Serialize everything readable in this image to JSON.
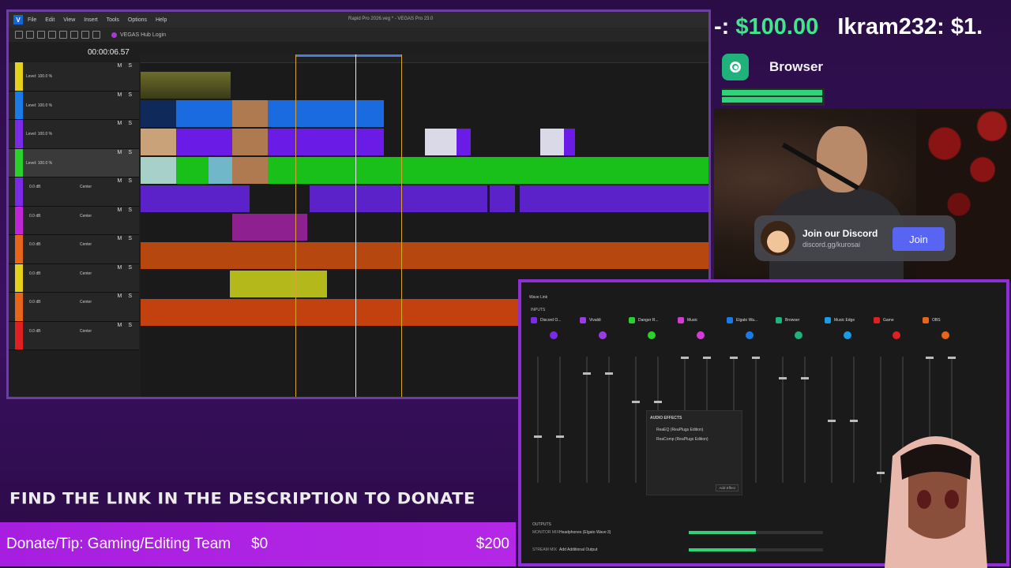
{
  "vegas": {
    "logo": "V",
    "menu": [
      "File",
      "Edit",
      "View",
      "Insert",
      "Tools",
      "Options",
      "Help"
    ],
    "window_title": "Rapid Pro 2026.veg * - VEGAS Pro 23.0",
    "hub_login": "VEGAS Hub Login",
    "timecode": "00:00:06.57",
    "video_tracks": [
      {
        "level": "Level: 100.0 %",
        "color": "#e6d21a",
        "buttons": "M S"
      },
      {
        "level": "Level: 100.0 %",
        "color": "#1a7be6",
        "buttons": "M S"
      },
      {
        "level": "Level: 100.0 %",
        "color": "#7b2be6",
        "buttons": "M S"
      },
      {
        "level": "Level: 100.0 %",
        "color": "#2ad12a",
        "buttons": "M S"
      }
    ],
    "audio_tracks": [
      {
        "vol": "0.0 dB",
        "pan": "Center",
        "color": "#7b2be6",
        "buttons": "M S"
      },
      {
        "vol": "0.0 dB",
        "pan": "Center",
        "color": "#c025d6",
        "buttons": "M S"
      },
      {
        "vol": "0.0 dB",
        "pan": "Center",
        "color": "#e6651a",
        "buttons": "M S"
      },
      {
        "vol": "0.0 dB",
        "pan": "Center",
        "color": "#e6d21a",
        "buttons": "M S"
      },
      {
        "vol": "0.0 dB",
        "pan": "Center",
        "color": "#e6651a",
        "buttons": "M S"
      },
      {
        "vol": "0.0 dB",
        "pan": "Center",
        "color": "#e02020",
        "buttons": "M S"
      }
    ]
  },
  "overlay": {
    "top_donation_name": "-: ",
    "top_donation_amount": "$100.00",
    "top_donation_second": "Ikram232: $1.",
    "browser_label": "Browser",
    "browser_level": 0.98,
    "discord_title": "Join our Discord",
    "discord_link": "discord.gg/kurosai",
    "discord_button": "Join",
    "find_link": "FIND THE LINK IN THE DESCRIPTION TO DONATE",
    "donate_label": "Donate/Tip: Gaming/Editing Team",
    "donate_current": "$0",
    "donate_goal": "$200"
  },
  "wavelink": {
    "title": "Wave Link",
    "inputs_label": "INPUTS",
    "channels": [
      {
        "name": "Discord O...",
        "color": "#7b2be6"
      },
      {
        "name": "Vivaldi",
        "color": "#9c3be6"
      },
      {
        "name": "Danger R...",
        "color": "#2ad12a"
      },
      {
        "name": "Music",
        "color": "#d63ad6"
      },
      {
        "name": "Elgato Wa...",
        "color": "#1a7be6"
      },
      {
        "name": "Browser",
        "color": "#1fb27a"
      },
      {
        "name": "Music Edge",
        "color": "#1a9be6"
      },
      {
        "name": "Game",
        "color": "#e02020"
      },
      {
        "name": "OBS",
        "color": "#e6651a"
      }
    ],
    "audio_effects": {
      "title": "AUDIO EFFECTS",
      "items": [
        "ReaEQ (ReaPlugs Edition)",
        "ReaComp (ReaPlugs Edition)"
      ],
      "add": "Add Effect"
    },
    "outputs_label": "OUTPUTS",
    "outputs": [
      {
        "mix": "MONITOR MIX",
        "device": "Headphones (Elgato Wave:3)",
        "level": 0.5
      },
      {
        "mix": "STREAM MIX",
        "device": "Add Additional Output",
        "level": 0.5
      }
    ]
  }
}
